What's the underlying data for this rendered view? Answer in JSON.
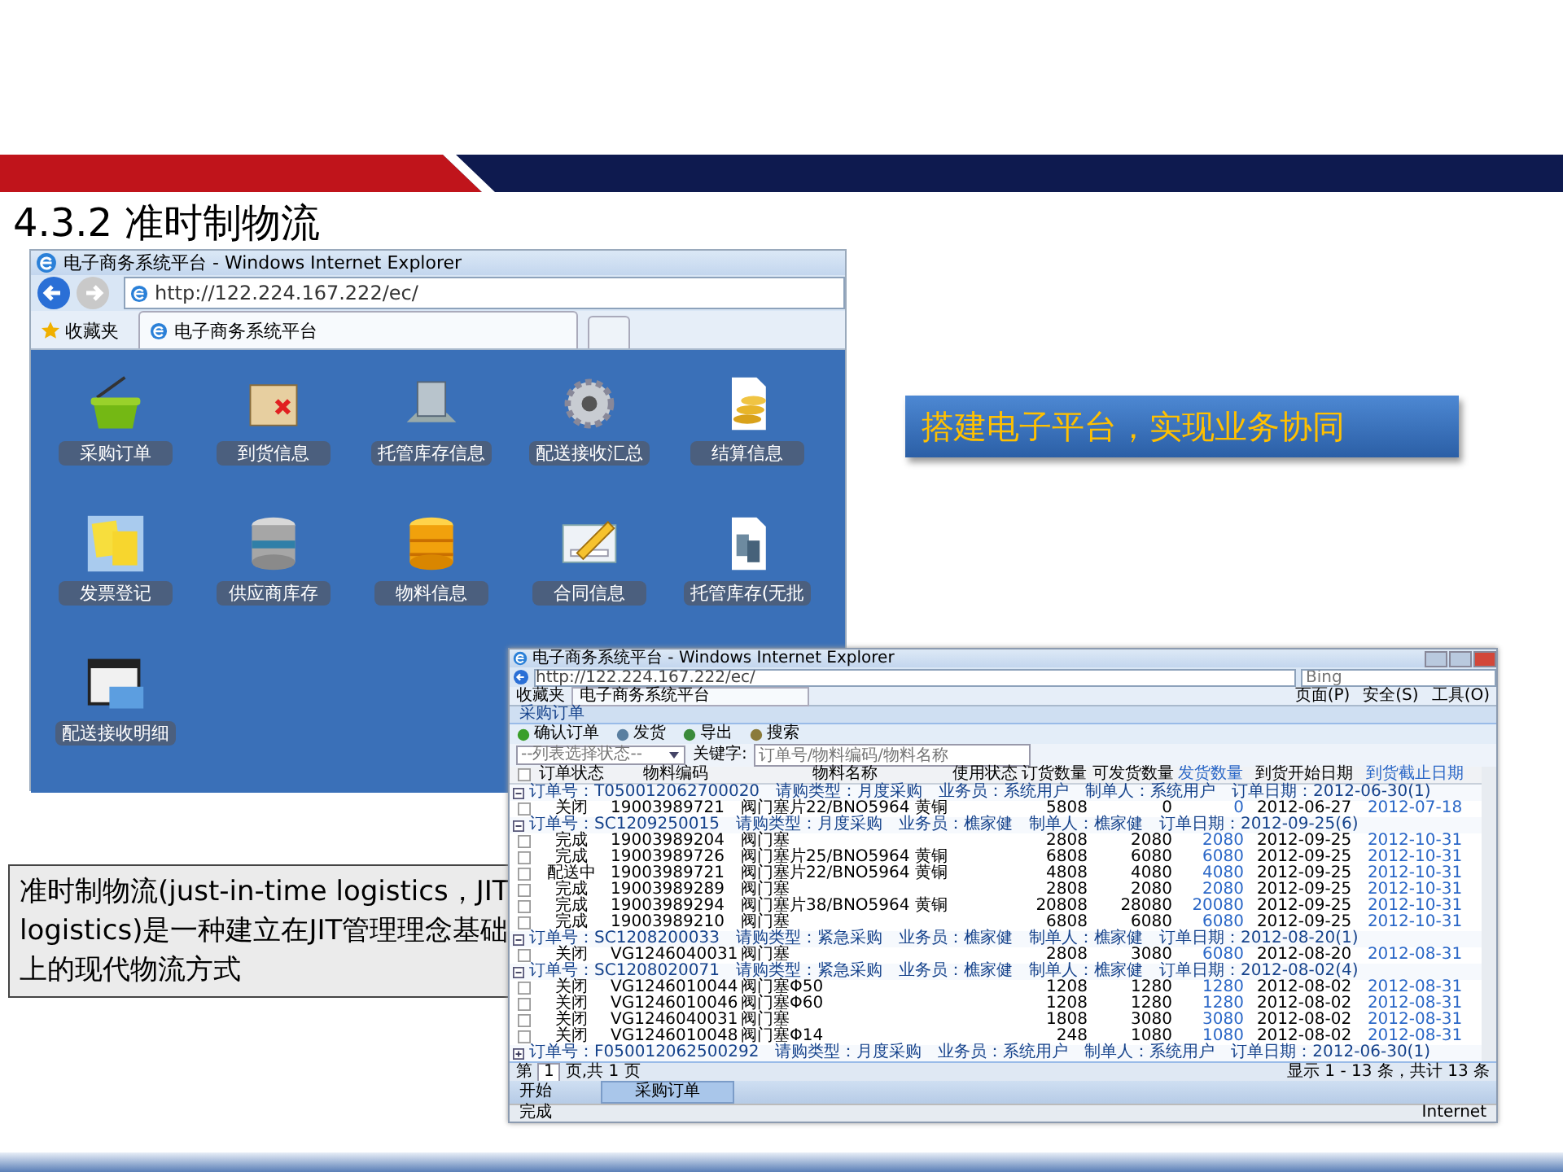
{
  "slide_title": "4.3.2 准时制物流",
  "browser": {
    "title": "电子商务系统平台 - Windows Internet Explorer",
    "address": "http://122.224.167.222/ec/",
    "favorites": "收藏夹",
    "tab": "电子商务系统平台",
    "apps": [
      {
        "label": "采购订单"
      },
      {
        "label": "到货信息"
      },
      {
        "label": "托管库存信息"
      },
      {
        "label": "配送接收汇总"
      },
      {
        "label": "结算信息"
      },
      {
        "label": "发票登记"
      },
      {
        "label": "供应商库存"
      },
      {
        "label": "物料信息"
      },
      {
        "label": "合同信息"
      },
      {
        "label": "托管库存(无批"
      },
      {
        "label": "配送接收明细"
      }
    ]
  },
  "callout": "搭建电子平台，实现业务协同",
  "note": "准时制物流(just-in-time logistics，JIT logistics)是一种建立在JIT管理理念基础上的现代物流方式",
  "order_window": {
    "title": "电子商务系统平台 - Windows Internet Explorer",
    "address": "http://122.224.167.222/ec/",
    "search_placeholder": "Bing",
    "favorites": "收藏夹",
    "tab": "电子商务系统平台",
    "menus": [
      "页面(P)",
      "安全(S)",
      "工具(O)"
    ],
    "panel_title": "采购订单",
    "toolbar": [
      "确认订单",
      "发货",
      "导出",
      "搜索"
    ],
    "status_filter": "--列表选择状态--",
    "keyword_label": "关键字:",
    "keyword_placeholder": "订单号/物料编码/物料名称",
    "select_all_checked": false,
    "columns": [
      "订单状态",
      "物料编码",
      "物料名称",
      "使用状态",
      "订货数量",
      "可发货数量",
      "发货数量",
      "到货开始日期",
      "到货截止日期"
    ],
    "rows": [
      {
        "kind": "group",
        "expanded": true,
        "text": "订单号：T050012062700020　请购类型：月度采购　业务员：系统用户　制单人：系统用户　订单日期：2012-06-30(1)"
      },
      {
        "kind": "item",
        "checked": false,
        "cells": [
          "关闭",
          "19003989721",
          "阀门塞片22/BNO5964 黄铜",
          "",
          "5808",
          "0",
          "0",
          "2012-06-27",
          "2012-07-18"
        ]
      },
      {
        "kind": "group",
        "expanded": true,
        "text": "订单号：SC1209250015　请购类型：月度采购　业务员：樵家健　制单人：樵家健　订单日期：2012-09-25(6)"
      },
      {
        "kind": "item",
        "checked": false,
        "cells": [
          "完成",
          "19003989204",
          "阀门塞",
          "",
          "2808",
          "2080",
          "2080",
          "2012-09-25",
          "2012-10-31"
        ]
      },
      {
        "kind": "item",
        "checked": false,
        "cells": [
          "完成",
          "19003989726",
          "阀门塞片25/BNO5964 黄铜",
          "",
          "6808",
          "6080",
          "6080",
          "2012-09-25",
          "2012-10-31"
        ]
      },
      {
        "kind": "item",
        "checked": false,
        "cells": [
          "配送中",
          "19003989721",
          "阀门塞片22/BNO5964 黄铜",
          "",
          "4808",
          "4080",
          "4080",
          "2012-09-25",
          "2012-10-31"
        ]
      },
      {
        "kind": "item",
        "checked": false,
        "cells": [
          "完成",
          "19003989289",
          "阀门塞",
          "",
          "2808",
          "2080",
          "2080",
          "2012-09-25",
          "2012-10-31"
        ]
      },
      {
        "kind": "item",
        "checked": false,
        "cells": [
          "完成",
          "19003989294",
          "阀门塞片38/BNO5964 黄铜",
          "",
          "20808",
          "28080",
          "20080",
          "2012-09-25",
          "2012-10-31"
        ]
      },
      {
        "kind": "item",
        "checked": false,
        "cells": [
          "完成",
          "19003989210",
          "阀门塞",
          "",
          "6808",
          "6080",
          "6080",
          "2012-09-25",
          "2012-10-31"
        ]
      },
      {
        "kind": "group",
        "expanded": true,
        "text": "订单号：SC1208200033　请购类型：紧急采购　业务员：樵家健　制单人：樵家健　订单日期：2012-08-20(1)"
      },
      {
        "kind": "item",
        "checked": false,
        "cells": [
          "关闭",
          "VG1246040031",
          "阀门塞",
          "",
          "2808",
          "3080",
          "6080",
          "2012-08-20",
          "2012-08-31"
        ]
      },
      {
        "kind": "group",
        "expanded": true,
        "text": "订单号：SC1208020071　请购类型：紧急采购　业务员：樵家健　制单人：樵家健　订单日期：2012-08-02(4)"
      },
      {
        "kind": "item",
        "checked": false,
        "cells": [
          "关闭",
          "VG1246010044",
          "阀门塞Φ50",
          "",
          "1208",
          "1280",
          "1280",
          "2012-08-02",
          "2012-08-31"
        ]
      },
      {
        "kind": "item",
        "checked": false,
        "cells": [
          "关闭",
          "VG1246010046",
          "阀门塞Φ60",
          "",
          "1208",
          "1280",
          "1280",
          "2012-08-02",
          "2012-08-31"
        ]
      },
      {
        "kind": "item",
        "checked": false,
        "cells": [
          "关闭",
          "VG1246040031",
          "阀门塞",
          "",
          "1808",
          "3080",
          "3080",
          "2012-08-02",
          "2012-08-31"
        ]
      },
      {
        "kind": "item",
        "checked": false,
        "cells": [
          "关闭",
          "VG1246010048",
          "阀门塞Φ14",
          "",
          "248",
          "1080",
          "1080",
          "2012-08-02",
          "2012-08-31"
        ]
      },
      {
        "kind": "group",
        "expanded": false,
        "text": "订单号：F050012062500292　请购类型：月度采购　业务员：系统用户　制单人：系统用户　订单日期：2012-06-30(1)"
      }
    ],
    "pager": {
      "page_prefix": "第",
      "page": "1",
      "page_suffix": "页,共 1 页",
      "summary": "显示 1 - 13 条，共计 13 条"
    },
    "taskbar": {
      "start": "开始",
      "task": "采购订单"
    },
    "status": {
      "left": "完成",
      "zone": "Internet"
    }
  }
}
